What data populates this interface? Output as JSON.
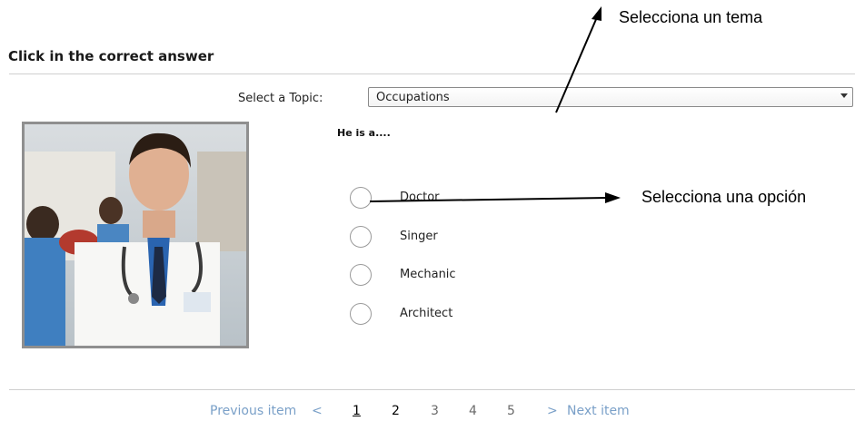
{
  "quiz": {
    "title": "Click in the correct answer",
    "topic_label": "Select a Topic:",
    "topic_selected": "Occupations",
    "question": "He is a....",
    "image_alt": "doctor-photo",
    "options": [
      {
        "label": "Doctor",
        "selected": false
      },
      {
        "label": "Singer",
        "selected": false
      },
      {
        "label": "Mechanic",
        "selected": false
      },
      {
        "label": "Architect",
        "selected": false
      }
    ]
  },
  "annotations": {
    "topic_note": "Selecciona un tema",
    "option_note": "Selecciona una opción"
  },
  "pagination": {
    "previous_label": "Previous item",
    "previous_symbol": "<",
    "pages": [
      "1",
      "2",
      "3",
      "4",
      "5"
    ],
    "current_page": "1",
    "next_symbol": ">",
    "next_label": "Next item"
  },
  "colors": {
    "link": "#7aa0c8",
    "border": "#cfcfcf",
    "annotation_arrow": "#000000"
  }
}
